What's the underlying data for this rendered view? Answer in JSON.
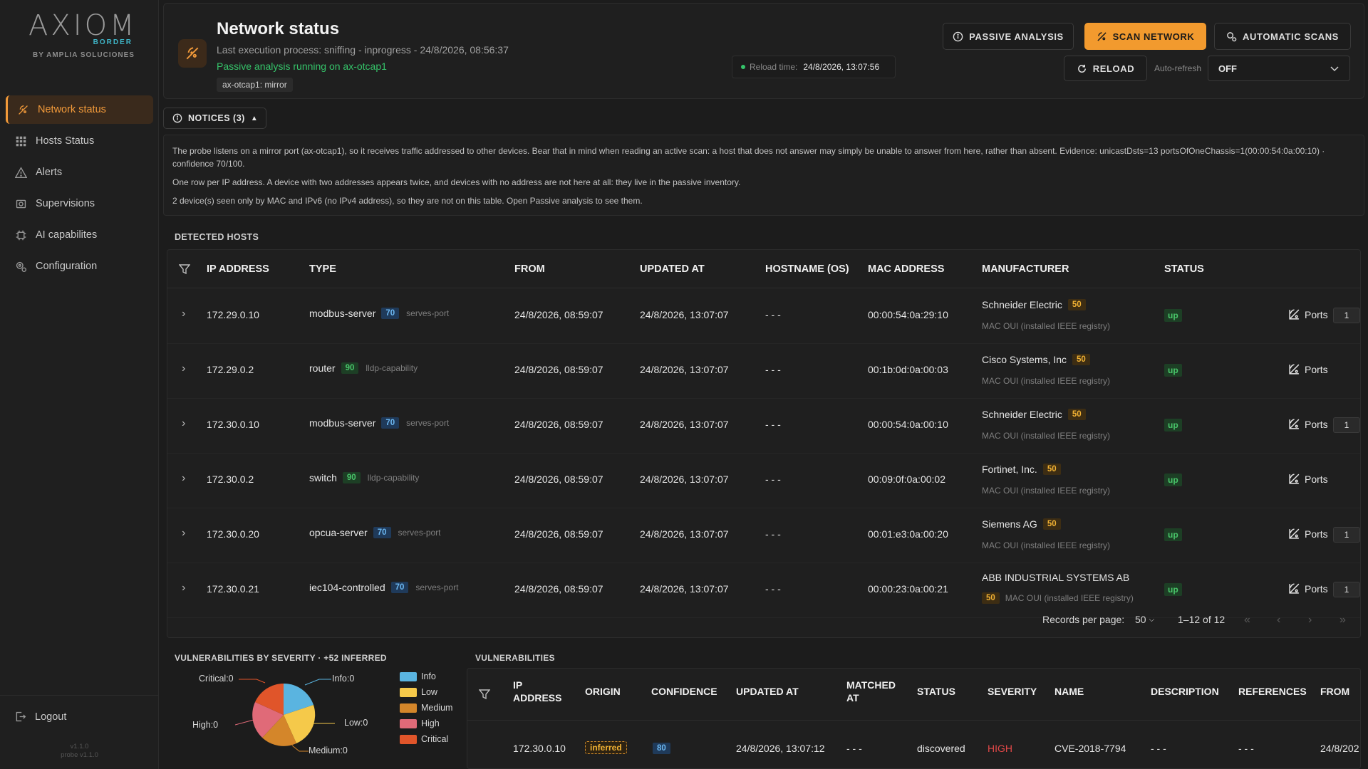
{
  "brand": {
    "name": "AXIOM",
    "tag": "BORDER",
    "sub": "BY AMPLIA SOLUCIONES"
  },
  "sidebar": {
    "items": [
      {
        "label": "Network status",
        "icon": "network-scan-icon",
        "active": true
      },
      {
        "label": "Hosts Status",
        "icon": "grid-icon"
      },
      {
        "label": "Alerts",
        "icon": "warning-icon"
      },
      {
        "label": "Supervisions",
        "icon": "supervision-icon"
      },
      {
        "label": "AI capabilites",
        "icon": "ai-icon"
      },
      {
        "label": "Configuration",
        "icon": "gear-icon"
      }
    ],
    "logout": "Logout",
    "version": "v1.1.0",
    "probe_version": "probe v1.1.0"
  },
  "header": {
    "title": "Network status",
    "subtitle": "Last execution process: sniffing - inprogress - 24/8/2026, 08:56:37",
    "passive_msg": "Passive analysis running on ax-otcap1",
    "tag": "ax-otcap1: mirror",
    "btn_passive": "PASSIVE ANALYSIS",
    "btn_scan": "SCAN NETWORK",
    "btn_auto": "AUTOMATIC SCANS",
    "reload_label": "Reload time:",
    "reload_time": "24/8/2026, 13:07:56",
    "btn_reload": "RELOAD",
    "autorefresh_label": "Auto-refresh",
    "autorefresh_value": "OFF"
  },
  "notices": {
    "button": "NOTICES (3)",
    "lines": [
      "The probe listens on a mirror port (ax-otcap1), so it receives traffic addressed to other devices. Bear that in mind when reading an active scan: a host that does not answer may simply be unable to answer from here, rather than absent. Evidence: unicastDsts=13 portsOfOneChassis=1(00:00:54:0a:00:10) · confidence 70/100.",
      "One row per IP address. A device with two addresses appears twice, and devices with no address are not here at all: they live in the passive inventory.",
      "2 device(s) seen only by MAC and IPv6 (no IPv4 address), so they are not on this table. Open Passive analysis to see them."
    ]
  },
  "hosts": {
    "title": "DETECTED HOSTS",
    "columns": [
      "IP ADDRESS",
      "TYPE",
      "FROM",
      "UPDATED AT",
      "HOSTNAME (OS)",
      "MAC ADDRESS",
      "MANUFACTURER",
      "STATUS"
    ],
    "rows": [
      {
        "ip": "172.29.0.10",
        "type": "modbus-server",
        "type_score": "70",
        "type_color": "blue",
        "type_src": "serves-port",
        "from": "24/8/2026, 08:59:07",
        "updated": "24/8/2026, 13:07:07",
        "hostname": "- - -",
        "mac": "00:00:54:0a:29:10",
        "mfr": "Schneider Electric",
        "mfr_score": "50",
        "mfr_src": "MAC OUI (installed IEEE registry)",
        "status": "up",
        "ports": "Ports",
        "port_count": "1"
      },
      {
        "ip": "172.29.0.2",
        "type": "router",
        "type_score": "90",
        "type_color": "green",
        "type_src": "lldp-capability",
        "from": "24/8/2026, 08:59:07",
        "updated": "24/8/2026, 13:07:07",
        "hostname": "- - -",
        "mac": "00:1b:0d:0a:00:03",
        "mfr": "Cisco Systems, Inc",
        "mfr_score": "50",
        "mfr_src": "MAC OUI (installed IEEE registry)",
        "status": "up",
        "ports": "Ports",
        "port_count": ""
      },
      {
        "ip": "172.30.0.10",
        "type": "modbus-server",
        "type_score": "70",
        "type_color": "blue",
        "type_src": "serves-port",
        "from": "24/8/2026, 08:59:07",
        "updated": "24/8/2026, 13:07:07",
        "hostname": "- - -",
        "mac": "00:00:54:0a:00:10",
        "mfr": "Schneider Electric",
        "mfr_score": "50",
        "mfr_src": "MAC OUI (installed IEEE registry)",
        "status": "up",
        "ports": "Ports",
        "port_count": "1"
      },
      {
        "ip": "172.30.0.2",
        "type": "switch",
        "type_score": "90",
        "type_color": "green",
        "type_src": "lldp-capability",
        "from": "24/8/2026, 08:59:07",
        "updated": "24/8/2026, 13:07:07",
        "hostname": "- - -",
        "mac": "00:09:0f:0a:00:02",
        "mfr": "Fortinet, Inc.",
        "mfr_score": "50",
        "mfr_src": "MAC OUI (installed IEEE registry)",
        "status": "up",
        "ports": "Ports",
        "port_count": ""
      },
      {
        "ip": "172.30.0.20",
        "type": "opcua-server",
        "type_score": "70",
        "type_color": "blue",
        "type_src": "serves-port",
        "from": "24/8/2026, 08:59:07",
        "updated": "24/8/2026, 13:07:07",
        "hostname": "- - -",
        "mac": "00:01:e3:0a:00:20",
        "mfr": "Siemens AG",
        "mfr_score": "50",
        "mfr_src": "MAC OUI (installed IEEE registry)",
        "status": "up",
        "ports": "Ports",
        "port_count": "1"
      },
      {
        "ip": "172.30.0.21",
        "type": "iec104-controlled",
        "type_score": "70",
        "type_color": "blue",
        "type_src": "serves-port",
        "from": "24/8/2026, 08:59:07",
        "updated": "24/8/2026, 13:07:07",
        "hostname": "- - -",
        "mac": "00:00:23:0a:00:21",
        "mfr": "ABB INDUSTRIAL SYSTEMS AB",
        "mfr_score": "50",
        "mfr_src": "MAC OUI (installed IEEE registry)",
        "status": "up",
        "ports": "Ports",
        "port_count": "1"
      }
    ],
    "pager": {
      "label": "Records per page:",
      "per_page": "50",
      "range": "1–12 of 12"
    }
  },
  "severity": {
    "title": "VULNERABILITIES BY SEVERITY · +52 INFERRED",
    "legend": [
      {
        "name": "Info",
        "color": "#5ab4e0"
      },
      {
        "name": "Low",
        "color": "#f5c94a"
      },
      {
        "name": "Medium",
        "color": "#d4862a"
      },
      {
        "name": "High",
        "color": "#e06a78"
      },
      {
        "name": "Critical",
        "color": "#e0552a"
      }
    ],
    "labels": {
      "critical": "Critical:0",
      "info": "Info:0",
      "high": "High:0",
      "low": "Low:0",
      "medium": "Medium:0"
    }
  },
  "vulns": {
    "title": "VULNERABILITIES",
    "columns": [
      "IP ADDRESS",
      "ORIGIN",
      "CONFIDENCE",
      "UPDATED AT",
      "MATCHED AT",
      "STATUS",
      "SEVERITY",
      "NAME",
      "DESCRIPTION",
      "REFERENCES",
      "FROM"
    ],
    "row": {
      "ip": "172.30.0.10",
      "origin": "inferred",
      "confidence": "80",
      "updated": "24/8/2026, 13:07:12",
      "matched": "- - -",
      "status": "discovered",
      "severity": "HIGH",
      "name": "CVE-2018-7794",
      "description": "- - -",
      "references": "- - -",
      "from": "24/8/202"
    }
  }
}
